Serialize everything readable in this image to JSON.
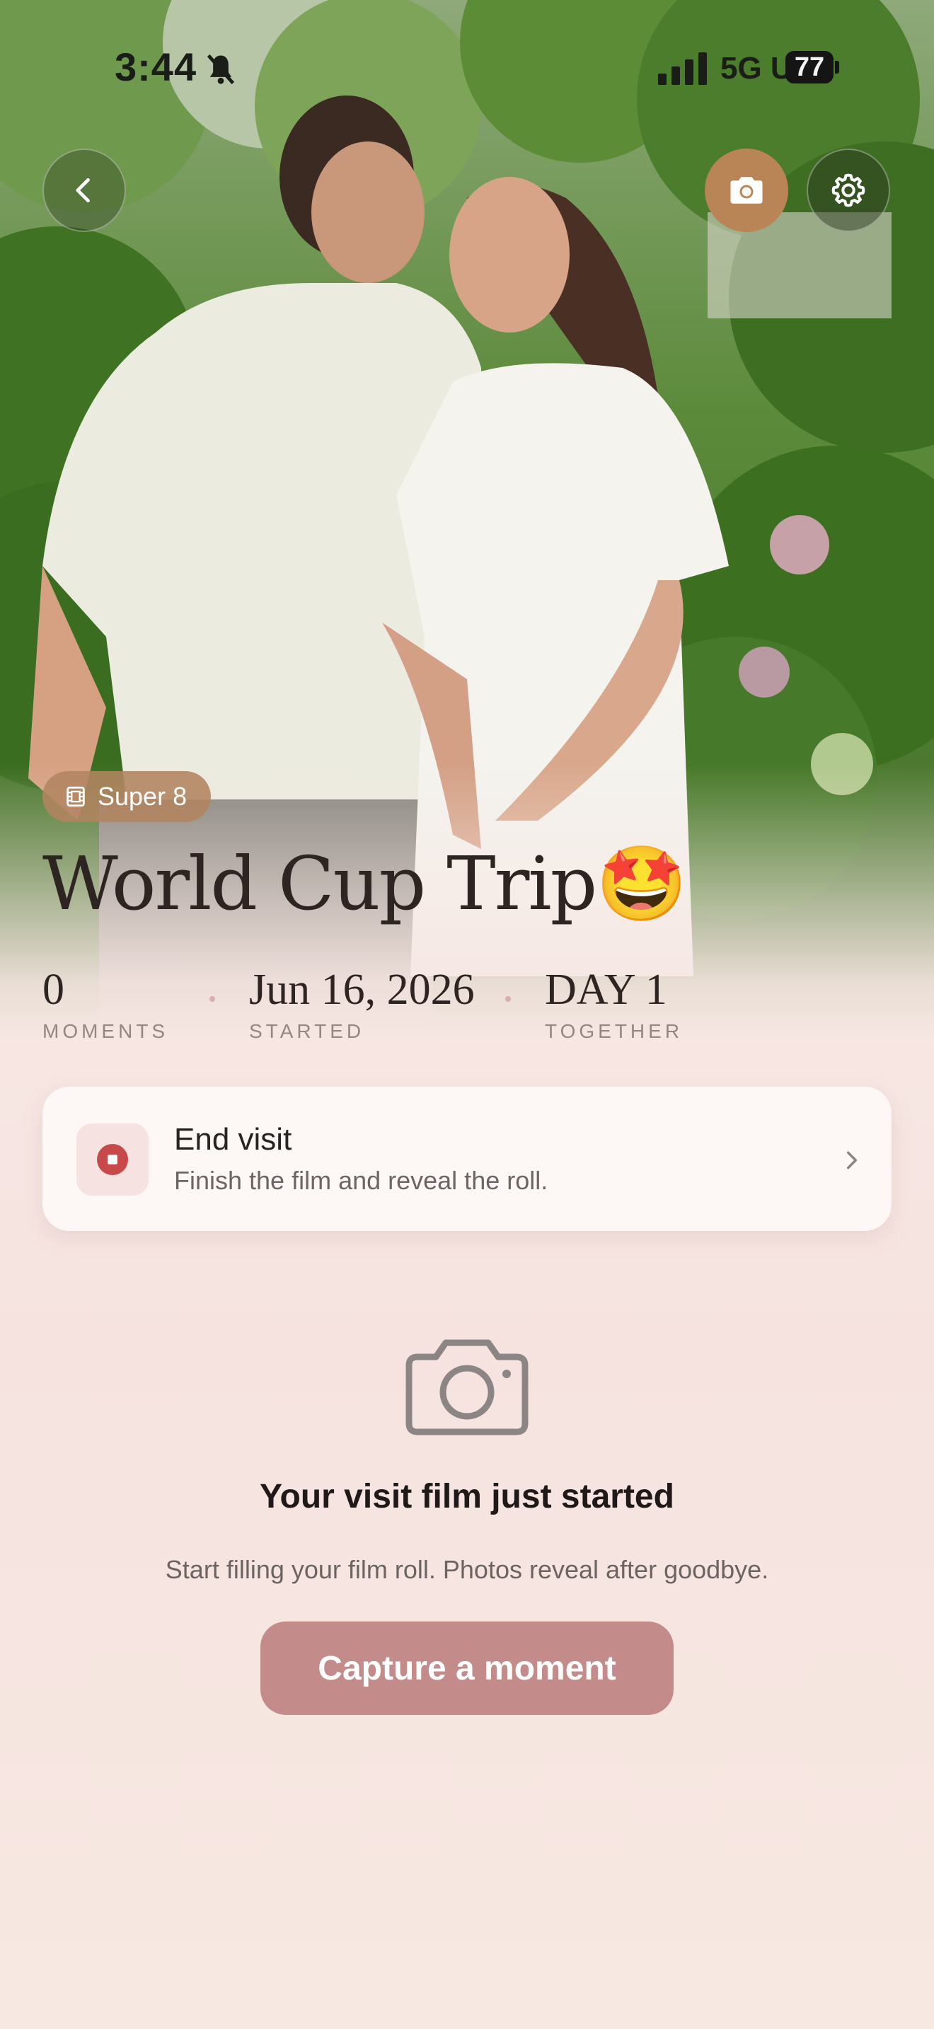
{
  "status_bar": {
    "time": "3:44",
    "network": "5G UC",
    "battery": "77"
  },
  "hero": {
    "film_badge": "Super 8",
    "title": "World Cup Trip🤩"
  },
  "stats": [
    {
      "value": "0",
      "label": "MOMENTS"
    },
    {
      "value": "Jun 16, 2026",
      "label": "STARTED"
    },
    {
      "value": "DAY 1",
      "label": "TOGETHER"
    }
  ],
  "end_visit": {
    "title": "End visit",
    "subtitle": "Finish the film and reveal the roll."
  },
  "empty_state": {
    "title": "Your visit film just started",
    "subtitle": "Start filling your film roll. Photos reveal after goodbye.",
    "button_label": "Capture a moment"
  },
  "colors": {
    "accent": "#c38c8b",
    "camera_button": "#b98556",
    "badge": "#b28460",
    "stop": "#c8494a",
    "background": "#f7e7e3"
  },
  "icons": [
    "bell-slash-icon",
    "signal-icon",
    "back-chevron-icon",
    "camera-icon",
    "gear-icon",
    "film-icon",
    "stop-icon",
    "chevron-right-icon",
    "camera-outline-icon"
  ]
}
